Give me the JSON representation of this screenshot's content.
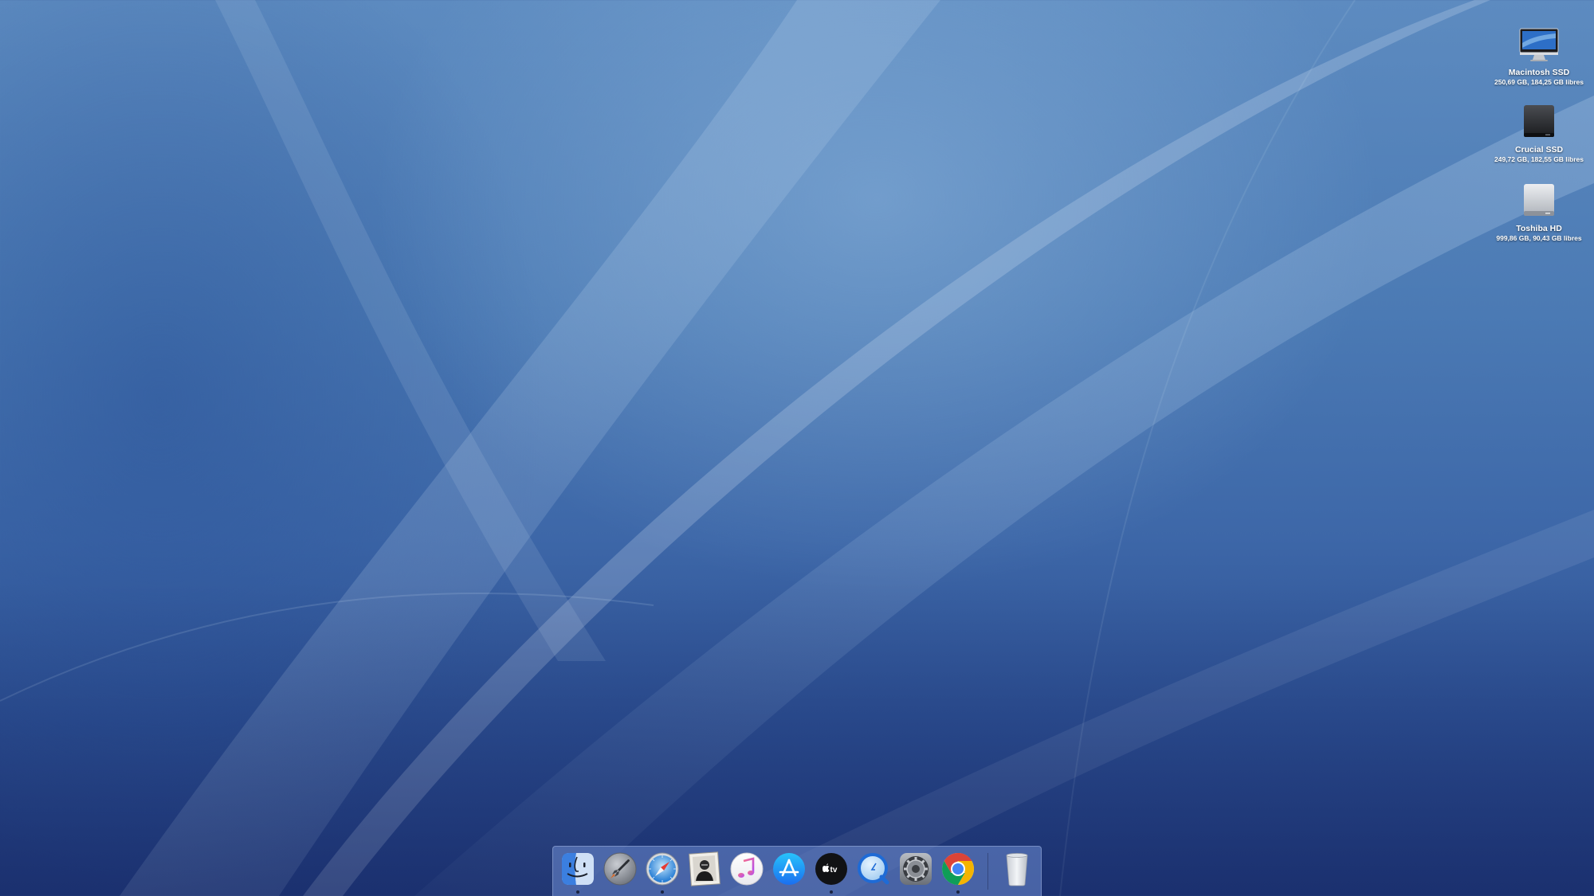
{
  "desktop": {
    "items": [
      {
        "name": "Macintosh SSD",
        "info": "250,69 GB, 184,25 GB libres",
        "icon": "imac-icon"
      },
      {
        "name": "Crucial SSD",
        "info": "249,72 GB, 182,55 GB libres",
        "icon": "external-drive-icon"
      },
      {
        "name": "Toshiba HD",
        "info": "999,86 GB, 90,43 GB libres",
        "icon": "hard-drive-icon"
      }
    ]
  },
  "dock": {
    "apps": [
      {
        "name": "Finder",
        "icon": "finder-icon",
        "running": true
      },
      {
        "name": "Launchpad",
        "icon": "rocket-icon",
        "running": false
      },
      {
        "name": "Safari",
        "icon": "compass-icon",
        "running": true
      },
      {
        "name": "Photo Booth",
        "icon": "portrait-icon",
        "running": false
      },
      {
        "name": "Music",
        "icon": "music-note-icon",
        "running": false
      },
      {
        "name": "App Store",
        "icon": "app-store-icon",
        "running": false
      },
      {
        "name": "TV",
        "icon": "apple-tv-icon",
        "running": true
      },
      {
        "name": "QuickTime Player",
        "icon": "quicktime-icon",
        "running": false
      },
      {
        "name": "System Preferences",
        "icon": "gear-icon",
        "running": false
      },
      {
        "name": "Google Chrome",
        "icon": "chrome-icon",
        "running": true
      }
    ],
    "trash": {
      "name": "Trash",
      "icon": "trash-icon"
    },
    "tv_label": "tv"
  },
  "colors": {
    "wallpaper_top": "#5d8bc0",
    "wallpaper_bottom": "#22397a",
    "dock_background": "#6e8cd2"
  }
}
